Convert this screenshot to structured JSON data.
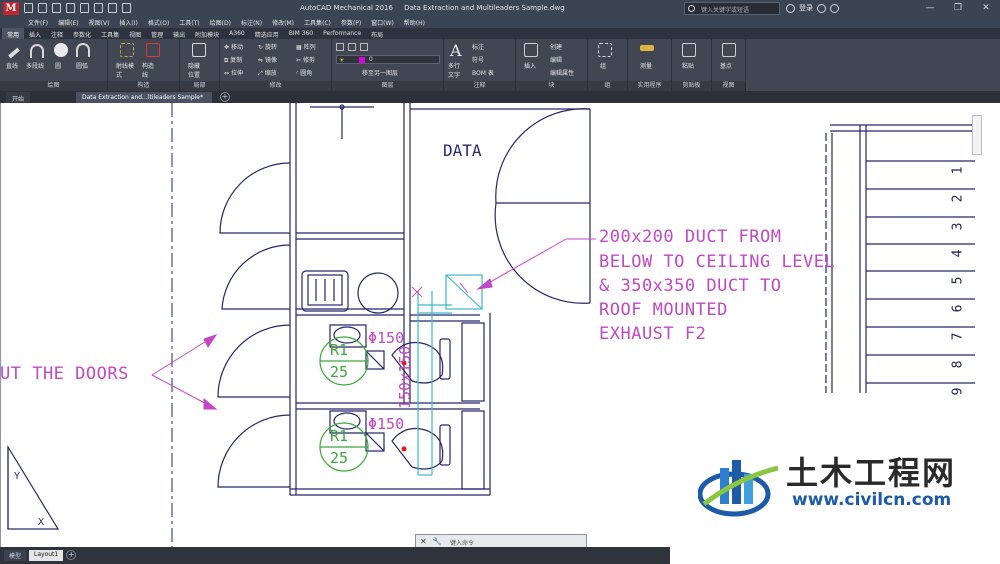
{
  "titlebar": {
    "app_name": "AutoCAD Mechanical 2016",
    "file_name": "Data Extraction and Multileaders Sample.dwg",
    "search_placeholder": "键入关键字或短语",
    "signin": "登录"
  },
  "menu": [
    "文件(F)",
    "编辑(E)",
    "视图(V)",
    "插入(I)",
    "格式(O)",
    "工具(T)",
    "绘图(D)",
    "标注(N)",
    "修改(M)",
    "工具集(C)",
    "参数(P)",
    "窗口(W)",
    "帮助(H)"
  ],
  "ribbon_tabs": [
    "常用",
    "插入",
    "注释",
    "参数化",
    "工具集",
    "视图",
    "管理",
    "输出",
    "附加模块",
    "A360",
    "精选应用",
    "BIM 360",
    "Performance",
    "布局"
  ],
  "ribbon": {
    "draw": {
      "label": "绘图",
      "tools": [
        "直线",
        "多段线",
        "圆",
        "圆弧"
      ]
    },
    "construct": {
      "label": "构造",
      "tools": [
        "射线模式",
        "构造线"
      ]
    },
    "detail": {
      "label": "局部",
      "tools": [
        "隐藏位置"
      ]
    },
    "modify": {
      "label": "修改",
      "tools": [
        "移动",
        "旋转",
        "修剪",
        "复制",
        "镜像",
        "圆角",
        "拉伸",
        "缩放",
        "阵列"
      ]
    },
    "layers": {
      "label": "图层",
      "layer_value": "0",
      "match_label": "移至另一图层"
    },
    "annotation": {
      "label": "注释",
      "tools": [
        "多行文字",
        "标注",
        "符号",
        "BOM 表"
      ]
    },
    "block": {
      "label": "块",
      "tools": [
        "插入",
        "创建",
        "编辑",
        "编辑属性"
      ]
    },
    "groups": {
      "label": "组",
      "tools": [
        "组"
      ]
    },
    "utilities": {
      "label": "实用程序",
      "tools": [
        "测量"
      ]
    },
    "clipboard": {
      "label": "剪贴板",
      "tools": [
        "粘贴"
      ]
    },
    "view": {
      "label": "视图",
      "tools": [
        "基点"
      ]
    }
  },
  "doc_tabs": {
    "start": "开始",
    "file": "Data Extraction and...ltileaders Sample*"
  },
  "drawing": {
    "room_label": "DATA",
    "duct_note": [
      "200x200 DUCT FROM",
      "BELOW TO CEILING LEVEL",
      "& 350x350 DUCT TO",
      "ROOF MOUNTED",
      "EXHAUST F2"
    ],
    "doors_note": "UT THE DOORS",
    "room_tag_1": {
      "code": "R1",
      "value": "25",
      "diameter": "Φ150"
    },
    "room_tag_2": {
      "code": "R1",
      "value": "25",
      "diameter": "Φ150"
    },
    "duct_size": "150x150",
    "stair_numbers": [
      "1",
      "2",
      "3",
      "4",
      "5",
      "6",
      "7",
      "8",
      "9"
    ]
  },
  "command_line": {
    "prompt": "键入命令"
  },
  "layout_tabs": [
    "模型",
    "Layout1"
  ],
  "watermark": {
    "cn": "土木工程网",
    "url": "www.civilcn.com"
  },
  "colors": {
    "annotation": "#c249c3",
    "tag": "#3aa83a",
    "duct": "#39b9c9",
    "line": "#26266a",
    "ribbon": "#404652"
  }
}
